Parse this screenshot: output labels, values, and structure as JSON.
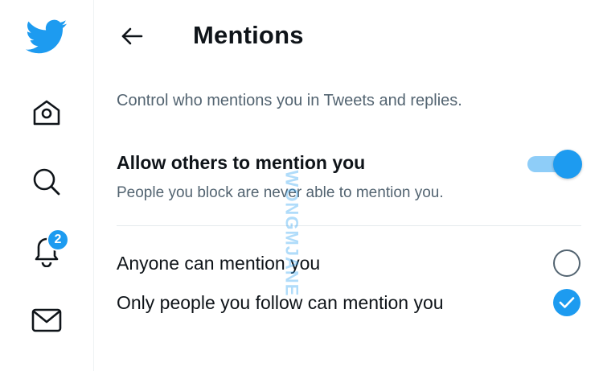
{
  "sidebar": {
    "logo": "twitter-bird-icon",
    "items": [
      {
        "name": "home",
        "icon": "home-icon"
      },
      {
        "name": "search",
        "icon": "search-icon"
      },
      {
        "name": "notifications",
        "icon": "bell-icon",
        "badge": "2"
      },
      {
        "name": "messages",
        "icon": "envelope-icon"
      }
    ]
  },
  "header": {
    "back_icon": "arrow-left-icon",
    "title": "Mentions"
  },
  "description": "Control who mentions you in Tweets and replies.",
  "allow_setting": {
    "title": "Allow others to mention you",
    "subtitle": "People you block are never able to mention you.",
    "enabled": true
  },
  "options": [
    {
      "label": "Anyone can mention you",
      "selected": false
    },
    {
      "label": "Only people you follow can mention you",
      "selected": true
    }
  ],
  "watermark": "WONGMJANE",
  "colors": {
    "accent": "#1d9bf0",
    "text_primary": "#0f1419",
    "text_secondary": "#536471"
  }
}
